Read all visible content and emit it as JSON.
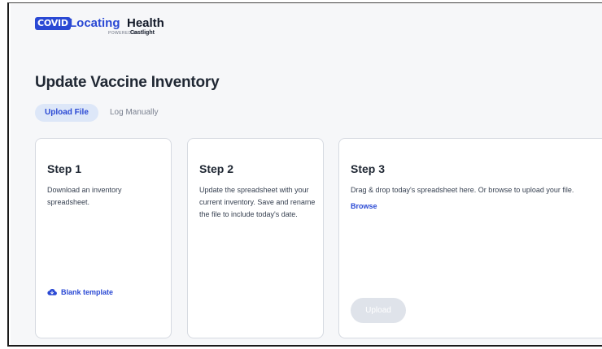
{
  "header": {
    "logo_badge": "COVID",
    "logo_word1": "Locating",
    "logo_word2": "Health",
    "logo_powered": "POWERED BY",
    "logo_castlight": "Castlight"
  },
  "page_title": "Update Vaccine Inventory",
  "tabs": [
    {
      "label": "Upload File",
      "active": true
    },
    {
      "label": "Log Manually",
      "active": false
    }
  ],
  "steps": [
    {
      "title": "Step 1",
      "description": "Download an inventory spreadsheet.",
      "link_label": "Blank template",
      "link_icon": "cloud-download-icon"
    },
    {
      "title": "Step 2",
      "description": "Update the spreadsheet with your current inventory. Save and rename the file to include today's date."
    },
    {
      "title": "Step 3",
      "description": "Drag & drop today's spreadsheet here. Or browse to upload your file.",
      "browse_label": "Browse",
      "upload_label": "Upload"
    }
  ],
  "colors": {
    "brand_blue": "#2a49d4",
    "tab_active_bg": "#dde7f8",
    "page_bg": "#f6f7f9",
    "disabled_button": "#dfe3ea"
  }
}
